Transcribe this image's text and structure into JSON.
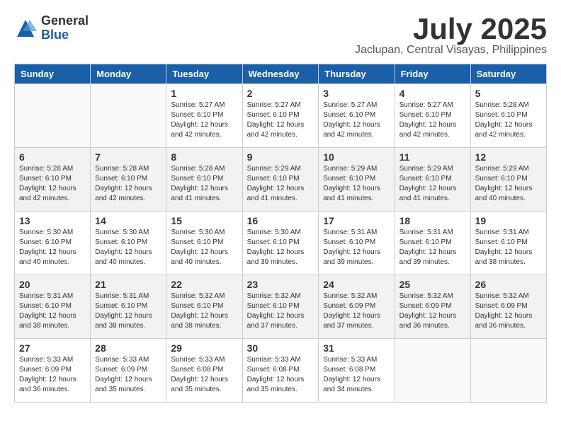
{
  "logo": {
    "general": "General",
    "blue": "Blue"
  },
  "title": {
    "month": "July 2025",
    "location": "Jaclupan, Central Visayas, Philippines"
  },
  "headers": [
    "Sunday",
    "Monday",
    "Tuesday",
    "Wednesday",
    "Thursday",
    "Friday",
    "Saturday"
  ],
  "weeks": [
    [
      {
        "day": "",
        "info": ""
      },
      {
        "day": "",
        "info": ""
      },
      {
        "day": "1",
        "info": "Sunrise: 5:27 AM\nSunset: 6:10 PM\nDaylight: 12 hours and 42 minutes."
      },
      {
        "day": "2",
        "info": "Sunrise: 5:27 AM\nSunset: 6:10 PM\nDaylight: 12 hours and 42 minutes."
      },
      {
        "day": "3",
        "info": "Sunrise: 5:27 AM\nSunset: 6:10 PM\nDaylight: 12 hours and 42 minutes."
      },
      {
        "day": "4",
        "info": "Sunrise: 5:27 AM\nSunset: 6:10 PM\nDaylight: 12 hours and 42 minutes."
      },
      {
        "day": "5",
        "info": "Sunrise: 5:28 AM\nSunset: 6:10 PM\nDaylight: 12 hours and 42 minutes."
      }
    ],
    [
      {
        "day": "6",
        "info": "Sunrise: 5:28 AM\nSunset: 6:10 PM\nDaylight: 12 hours and 42 minutes."
      },
      {
        "day": "7",
        "info": "Sunrise: 5:28 AM\nSunset: 6:10 PM\nDaylight: 12 hours and 42 minutes."
      },
      {
        "day": "8",
        "info": "Sunrise: 5:28 AM\nSunset: 6:10 PM\nDaylight: 12 hours and 41 minutes."
      },
      {
        "day": "9",
        "info": "Sunrise: 5:29 AM\nSunset: 6:10 PM\nDaylight: 12 hours and 41 minutes."
      },
      {
        "day": "10",
        "info": "Sunrise: 5:29 AM\nSunset: 6:10 PM\nDaylight: 12 hours and 41 minutes."
      },
      {
        "day": "11",
        "info": "Sunrise: 5:29 AM\nSunset: 6:10 PM\nDaylight: 12 hours and 41 minutes."
      },
      {
        "day": "12",
        "info": "Sunrise: 5:29 AM\nSunset: 6:10 PM\nDaylight: 12 hours and 40 minutes."
      }
    ],
    [
      {
        "day": "13",
        "info": "Sunrise: 5:30 AM\nSunset: 6:10 PM\nDaylight: 12 hours and 40 minutes."
      },
      {
        "day": "14",
        "info": "Sunrise: 5:30 AM\nSunset: 6:10 PM\nDaylight: 12 hours and 40 minutes."
      },
      {
        "day": "15",
        "info": "Sunrise: 5:30 AM\nSunset: 6:10 PM\nDaylight: 12 hours and 40 minutes."
      },
      {
        "day": "16",
        "info": "Sunrise: 5:30 AM\nSunset: 6:10 PM\nDaylight: 12 hours and 39 minutes."
      },
      {
        "day": "17",
        "info": "Sunrise: 5:31 AM\nSunset: 6:10 PM\nDaylight: 12 hours and 39 minutes."
      },
      {
        "day": "18",
        "info": "Sunrise: 5:31 AM\nSunset: 6:10 PM\nDaylight: 12 hours and 39 minutes."
      },
      {
        "day": "19",
        "info": "Sunrise: 5:31 AM\nSunset: 6:10 PM\nDaylight: 12 hours and 38 minutes."
      }
    ],
    [
      {
        "day": "20",
        "info": "Sunrise: 5:31 AM\nSunset: 6:10 PM\nDaylight: 12 hours and 38 minutes."
      },
      {
        "day": "21",
        "info": "Sunrise: 5:31 AM\nSunset: 6:10 PM\nDaylight: 12 hours and 38 minutes."
      },
      {
        "day": "22",
        "info": "Sunrise: 5:32 AM\nSunset: 6:10 PM\nDaylight: 12 hours and 38 minutes."
      },
      {
        "day": "23",
        "info": "Sunrise: 5:32 AM\nSunset: 6:10 PM\nDaylight: 12 hours and 37 minutes."
      },
      {
        "day": "24",
        "info": "Sunrise: 5:32 AM\nSunset: 6:09 PM\nDaylight: 12 hours and 37 minutes."
      },
      {
        "day": "25",
        "info": "Sunrise: 5:32 AM\nSunset: 6:09 PM\nDaylight: 12 hours and 36 minutes."
      },
      {
        "day": "26",
        "info": "Sunrise: 5:32 AM\nSunset: 6:09 PM\nDaylight: 12 hours and 36 minutes."
      }
    ],
    [
      {
        "day": "27",
        "info": "Sunrise: 5:33 AM\nSunset: 6:09 PM\nDaylight: 12 hours and 36 minutes."
      },
      {
        "day": "28",
        "info": "Sunrise: 5:33 AM\nSunset: 6:09 PM\nDaylight: 12 hours and 35 minutes."
      },
      {
        "day": "29",
        "info": "Sunrise: 5:33 AM\nSunset: 6:08 PM\nDaylight: 12 hours and 35 minutes."
      },
      {
        "day": "30",
        "info": "Sunrise: 5:33 AM\nSunset: 6:08 PM\nDaylight: 12 hours and 35 minutes."
      },
      {
        "day": "31",
        "info": "Sunrise: 5:33 AM\nSunset: 6:08 PM\nDaylight: 12 hours and 34 minutes."
      },
      {
        "day": "",
        "info": ""
      },
      {
        "day": "",
        "info": ""
      }
    ]
  ]
}
